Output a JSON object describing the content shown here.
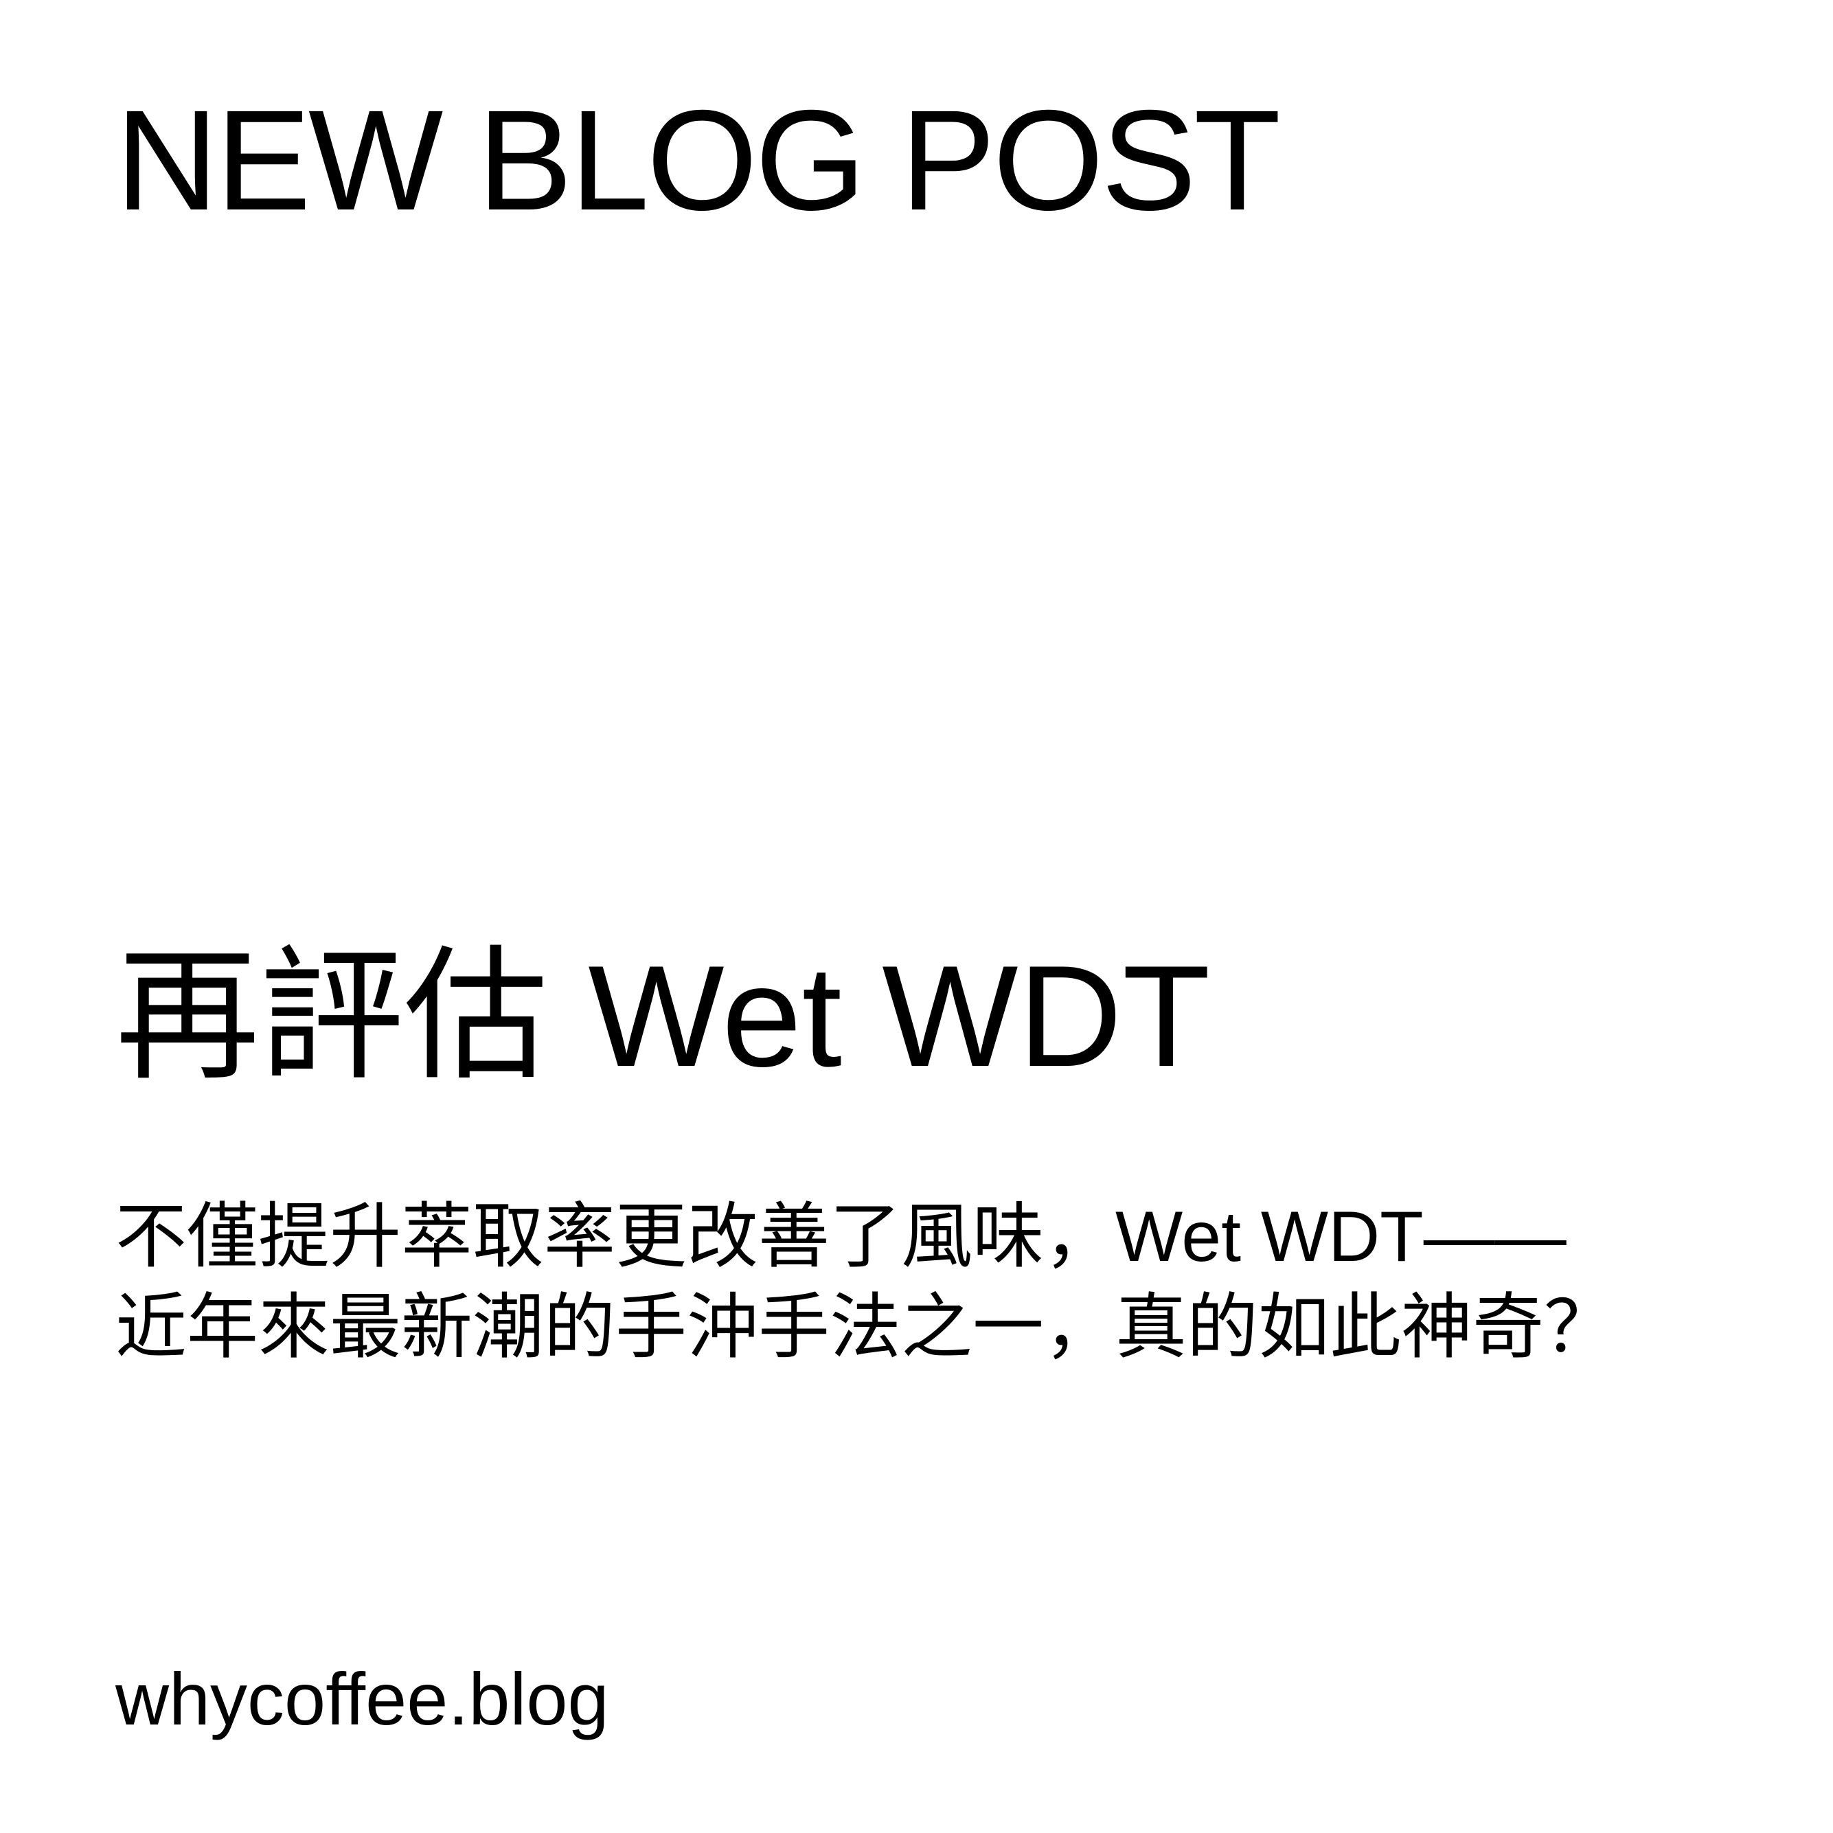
{
  "post": {
    "label": "NEW BLOG POST",
    "title": "再評估 Wet WDT",
    "subtitle_lines": [
      "不僅提升萃取率更改善了風味，Wet WDT——",
      "近年來最新潮的手沖手法之一，真的如此神奇？"
    ],
    "site": "whycoffee.blog"
  },
  "colors": {
    "background": "#ffffff",
    "text": "#000000"
  }
}
